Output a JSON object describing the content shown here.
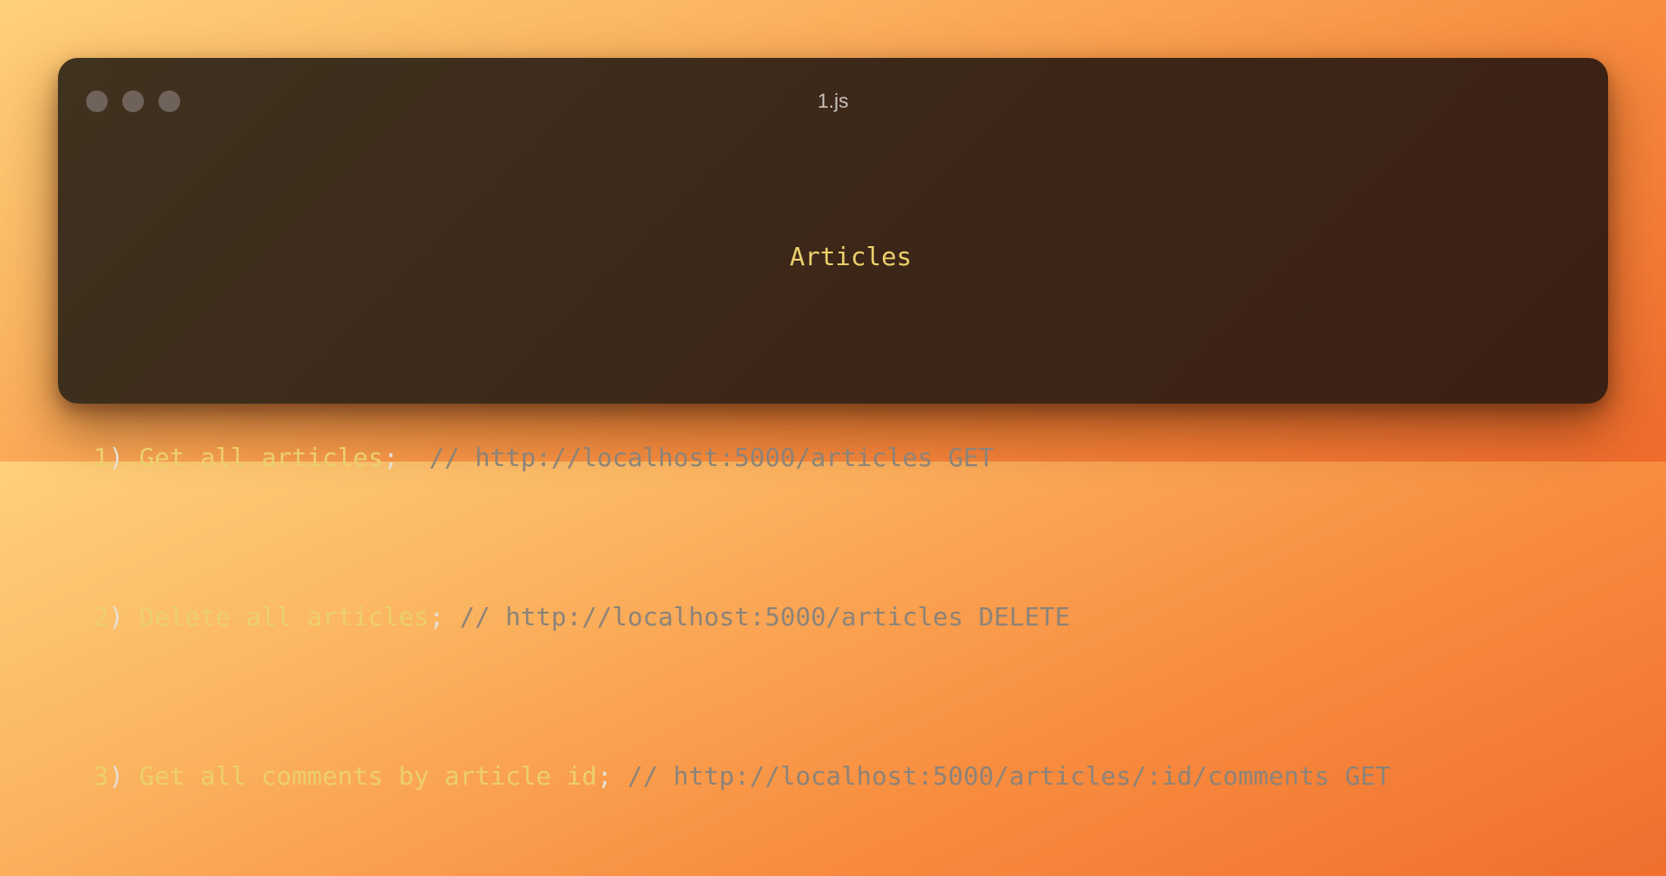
{
  "window": {
    "title": "1.js"
  },
  "code": {
    "heading": "Articles",
    "lines": [
      {
        "number": "1",
        "paren": ")",
        "statement": "Get all articles",
        "semicolon": ";",
        "spacer": "  ",
        "comment": "// http://localhost:5000/articles GET"
      },
      {
        "number": "2",
        "paren": ")",
        "statement": "Delete all articles",
        "semicolon": ";",
        "spacer": " ",
        "comment": "// http://localhost:5000/articles DELETE"
      },
      {
        "number": "3",
        "paren": ")",
        "statement": "Get all comments by article id",
        "semicolon": ";",
        "spacer": " ",
        "comment": "// http://localhost:5000/articles/:id/comments GET"
      }
    ]
  },
  "colors": {
    "background_start": "#ffd07a",
    "background_end": "#ef6b2c",
    "window_bg": "#3c2618",
    "keyword_yellow": "#ecd06b",
    "comment_gray": "#8c8379",
    "window_dot": "#6f625a"
  }
}
